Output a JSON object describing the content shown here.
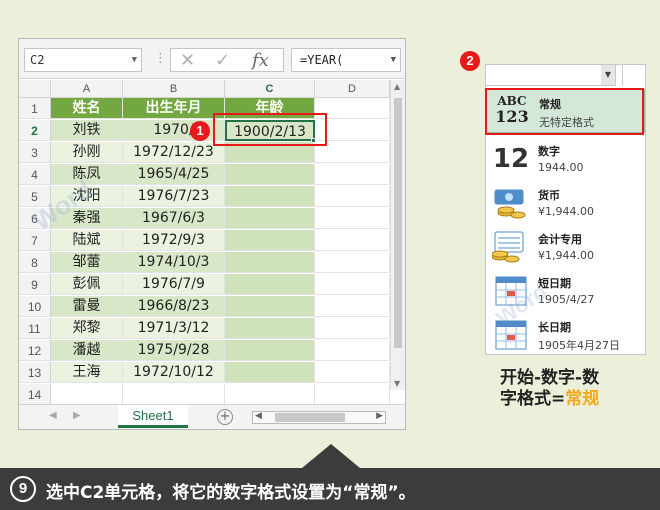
{
  "formula_bar": {
    "name_box": "C2",
    "formula": "=YEAR(",
    "fx_label": "fx"
  },
  "columns": [
    "A",
    "B",
    "C",
    "D"
  ],
  "row_numbers": [
    "1",
    "2",
    "3",
    "4",
    "5",
    "6",
    "7",
    "8",
    "9",
    "10",
    "11",
    "12",
    "13",
    "14"
  ],
  "headers": {
    "name": "姓名",
    "birth": "出生年月",
    "age": "年龄"
  },
  "rows": [
    {
      "name": "刘铁",
      "birth": "1970/",
      "age": "1900/2/13"
    },
    {
      "name": "孙刚",
      "birth": "1972/12/23",
      "age": ""
    },
    {
      "name": "陈凤",
      "birth": "1965/4/25",
      "age": ""
    },
    {
      "name": "沈阳",
      "birth": "1976/7/23",
      "age": ""
    },
    {
      "name": "秦强",
      "birth": "1967/6/3",
      "age": ""
    },
    {
      "name": "陆斌",
      "birth": "1972/9/3",
      "age": ""
    },
    {
      "name": "邹蕾",
      "birth": "1974/10/3",
      "age": ""
    },
    {
      "name": "彭佩",
      "birth": "1976/7/9",
      "age": ""
    },
    {
      "name": "雷曼",
      "birth": "1966/8/23",
      "age": ""
    },
    {
      "name": "郑黎",
      "birth": "1971/3/12",
      "age": ""
    },
    {
      "name": "潘越",
      "birth": "1975/9/28",
      "age": ""
    },
    {
      "name": "王海",
      "birth": "1972/10/12",
      "age": ""
    }
  ],
  "sheet_tab": "Sheet1",
  "markers": {
    "one": "1",
    "two": "2"
  },
  "format_panel": {
    "items": [
      {
        "name": "常规",
        "sample": "无特定格式",
        "icon": "general-abc123-icon",
        "icon_text_top": "ABC",
        "icon_text_bottom": "123"
      },
      {
        "name": "数字",
        "sample": "1944.00",
        "icon": "number-12-icon",
        "icon_text": "12"
      },
      {
        "name": "货币",
        "sample": "¥1,944.00",
        "icon": "currency-icon"
      },
      {
        "name": "会计专用",
        "sample": " ¥1,944.00",
        "icon": "accounting-icon"
      },
      {
        "name": "短日期",
        "sample": "1905/4/27",
        "icon": "short-date-calendar-icon"
      },
      {
        "name": "长日期",
        "sample": "1905年4月27日",
        "icon": "long-date-calendar-icon"
      }
    ]
  },
  "caption": {
    "line1": "开始-数字-数",
    "line2_prefix": "字格式=",
    "line2_highlight": "常规"
  },
  "step": {
    "number": "9",
    "text": "选中C2单元格，将它的数字格式设置为“常规”。"
  },
  "watermark": "Word联盟",
  "colors": {
    "header_green": "#73a73f",
    "row_green": "#d8e7c8",
    "accent_red": "#e8191b",
    "excel_green": "#217346",
    "highlight_orange": "#f2a81c"
  }
}
